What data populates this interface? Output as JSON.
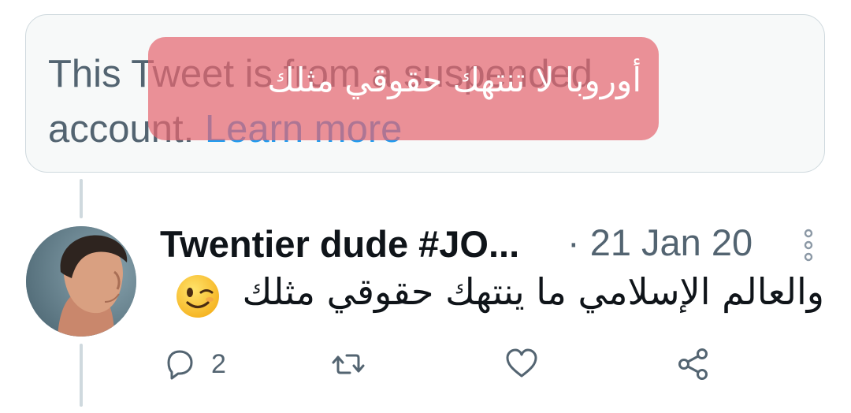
{
  "suspended_notice": {
    "text": "This Tweet is from a suspended account.",
    "link": "Learn more"
  },
  "overlay": {
    "text": "أوروبا لا تنتهك حقوقي مثلك"
  },
  "tweet": {
    "author": "Twentier dude #JO...",
    "date": "· 21 Jan 20",
    "text": "والعالم الإسلامي ما ينتهك حقوقي مثلك",
    "emoji": "winking-face",
    "actions": {
      "reply_count": "2"
    }
  },
  "colors": {
    "secondary_text": "#536471",
    "link": "#1d9bf0",
    "border": "#cfd9de",
    "overlay": "#e46670"
  }
}
